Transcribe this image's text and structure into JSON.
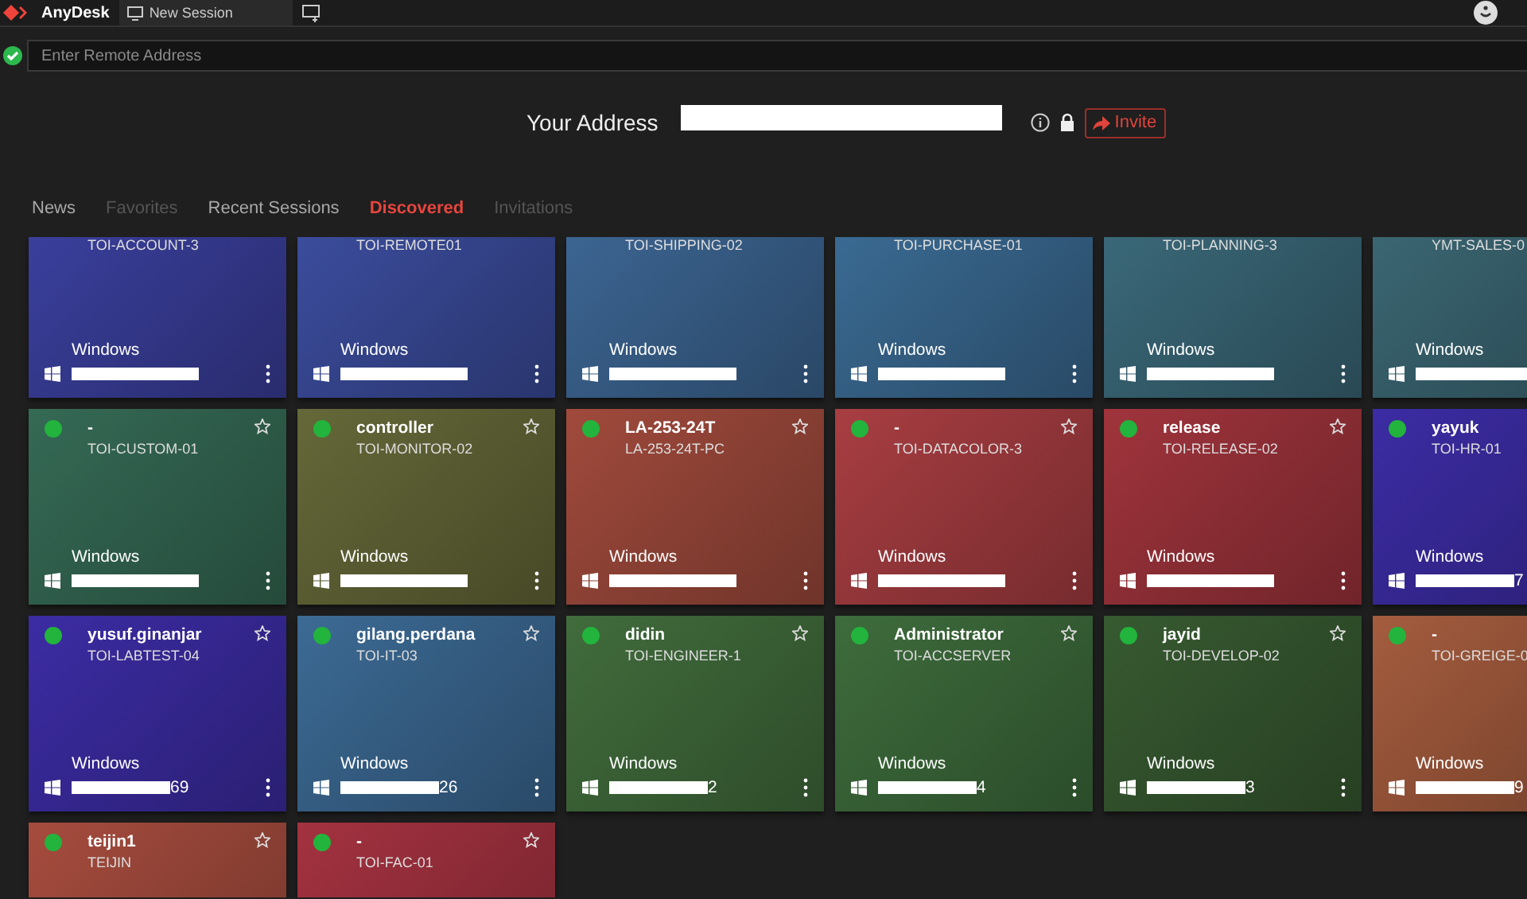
{
  "app": {
    "name": "AnyDesk"
  },
  "session_tabs": [
    {
      "label": "New Session",
      "selected": true
    }
  ],
  "remote_address": {
    "placeholder": "Enter Remote Address",
    "connected": true
  },
  "your_address": {
    "label": "Your Address",
    "redacted": true,
    "invite_label": "Invite"
  },
  "tabs": [
    {
      "label": "News",
      "selected": false,
      "disabled": false
    },
    {
      "label": "Favorites",
      "selected": false,
      "disabled": true
    },
    {
      "label": "Recent Sessions",
      "selected": false,
      "disabled": false
    },
    {
      "label": "Discovered",
      "selected": true,
      "disabled": false
    },
    {
      "label": "Invitations",
      "selected": false,
      "disabled": true
    }
  ],
  "devices": [
    {
      "hostname": "TOI-ACCOUNT-3",
      "os": "Windows",
      "color": "#3a3f9c"
    },
    {
      "hostname": "TOI-REMOTE01",
      "os": "Windows",
      "color": "#3b4c9c"
    },
    {
      "hostname": "TOI-SHIPPING-02",
      "os": "Windows",
      "color": "#3c6592"
    },
    {
      "hostname": "TOI-PURCHASE-01",
      "os": "Windows",
      "color": "#3a6a92"
    },
    {
      "hostname": "TOI-PLANNING-3",
      "os": "Windows",
      "color": "#3a6878"
    },
    {
      "hostname": "YMT-SALES-0",
      "os": "Windows",
      "color": "#3a6672"
    },
    {
      "name": "-",
      "hostname": "TOI-CUSTOM-01",
      "os": "Windows",
      "online": true,
      "favorite": false,
      "color": "#356a55"
    },
    {
      "name": "controller",
      "hostname": "TOI-MONITOR-02",
      "os": "Windows",
      "online": true,
      "favorite": false,
      "color": "#656838"
    },
    {
      "name": "LA-253-24T",
      "hostname": "LA-253-24T-PC",
      "os": "Windows",
      "online": true,
      "favorite": false,
      "color": "#a04a3c"
    },
    {
      "name": "-",
      "hostname": "TOI-DATACOLOR-3",
      "os": "Windows",
      "online": true,
      "favorite": false,
      "color": "#a83e42"
    },
    {
      "name": "release",
      "hostname": "TOI-RELEASE-02",
      "os": "Windows",
      "online": true,
      "favorite": false,
      "color": "#a0343c"
    },
    {
      "name": "yayuk",
      "hostname": "TOI-HR-01",
      "os": "Windows",
      "online": true,
      "id_tail": "7",
      "color": "#3c2ca4"
    },
    {
      "name": "yusuf.ginanjar",
      "hostname": "TOI-LABTEST-04",
      "os": "Windows",
      "online": true,
      "favorite": false,
      "id_tail": "69",
      "color": "#3c2ca4"
    },
    {
      "name": "gilang.perdana",
      "hostname": "TOI-IT-03",
      "os": "Windows",
      "online": true,
      "favorite": false,
      "id_tail": "26",
      "color": "#3c6a94"
    },
    {
      "name": "didin",
      "hostname": "TOI-ENGINEER-1",
      "os": "Windows",
      "online": true,
      "favorite": false,
      "id_tail": "2",
      "color": "#416c3c"
    },
    {
      "name": "Administrator",
      "hostname": "TOI-ACCSERVER",
      "os": "Windows",
      "online": true,
      "favorite": false,
      "id_tail": "4",
      "color": "#3e6c3c"
    },
    {
      "name": "jayid",
      "hostname": "TOI-DEVELOP-02",
      "os": "Windows",
      "online": true,
      "favorite": false,
      "id_tail": "3",
      "color": "#375a31"
    },
    {
      "name": "-",
      "hostname": "TOI-GREIGE-0",
      "os": "Windows",
      "online": true,
      "id_tail": "9",
      "color": "#a45c3e"
    },
    {
      "name": "teijin1",
      "hostname": "TEIJIN",
      "online": true,
      "favorite": false,
      "color": "#a64c3e"
    },
    {
      "name": "-",
      "hostname": "TOI-FAC-01",
      "online": true,
      "favorite": false,
      "color": "#a43240"
    }
  ]
}
